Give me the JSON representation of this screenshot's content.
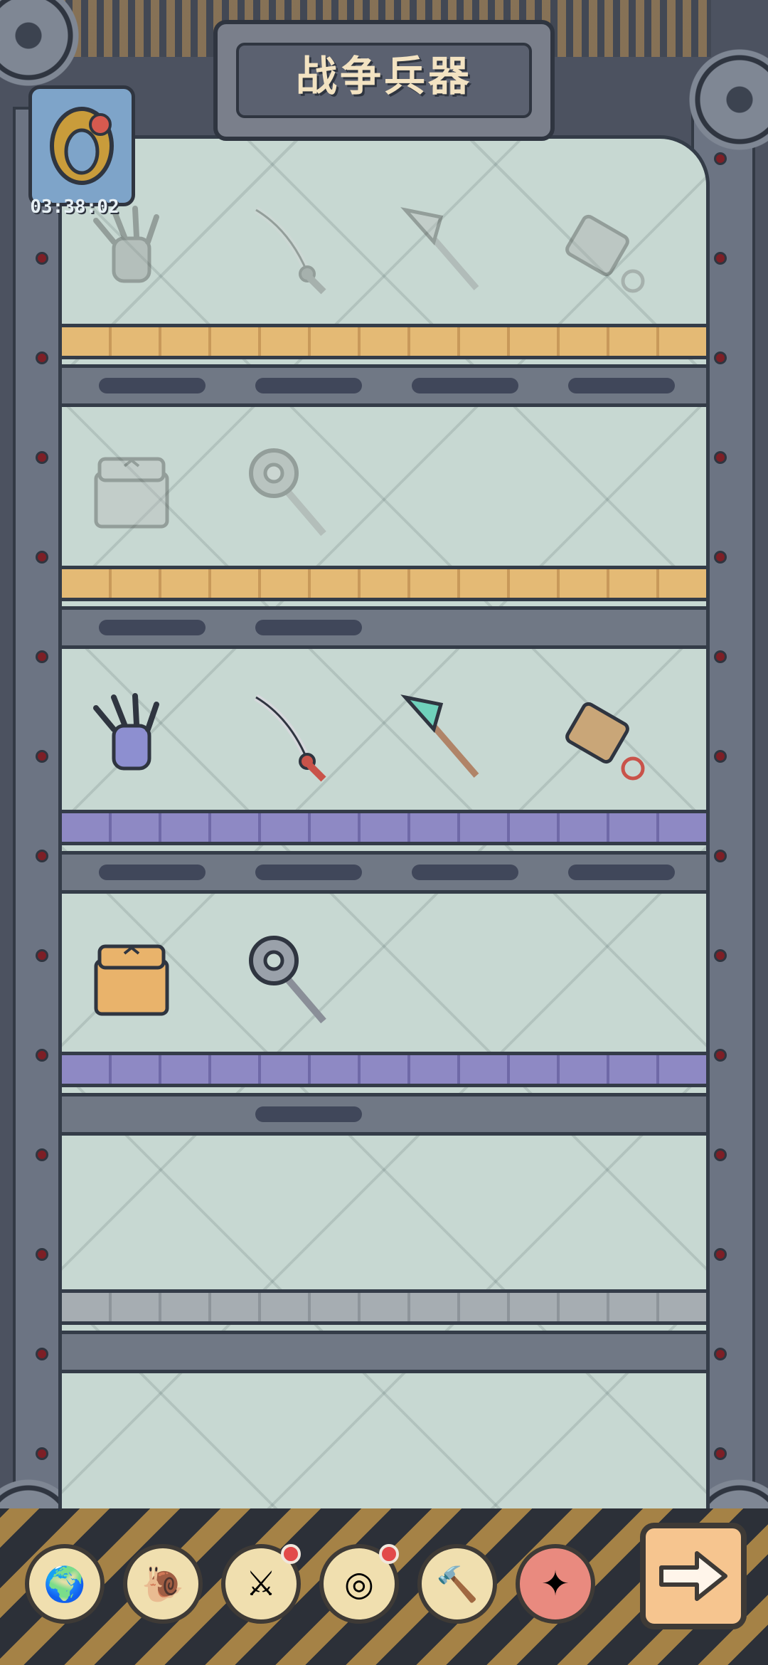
{
  "header": {
    "title": "战争兵器"
  },
  "timer": {
    "value": "03:38:02"
  },
  "shelves": [
    {
      "items": [
        "claw-gauntlet",
        "curved-sword",
        "spear",
        "blaster-rifle"
      ],
      "collected": false
    },
    {
      "items": [
        "treasure-chest",
        "spiral-staff"
      ],
      "collected": false
    },
    {
      "items": [
        "claw-gauntlet",
        "curved-sword",
        "spear",
        "blaster-rifle"
      ],
      "collected": true
    },
    {
      "items": [
        "treasure-chest",
        "spiral-staff"
      ],
      "collected": true
    }
  ],
  "nav": [
    {
      "icon": "globe-icon",
      "glyph": "🌍",
      "badge": false
    },
    {
      "icon": "snail-icon",
      "glyph": "🐌",
      "badge": false
    },
    {
      "icon": "sword-icon",
      "glyph": "⚔",
      "badge": true
    },
    {
      "icon": "spiral-icon",
      "glyph": "◎",
      "badge": true
    },
    {
      "icon": "hammer-icon",
      "glyph": "🔨",
      "badge": false
    },
    {
      "icon": "gun-icon",
      "glyph": "✦",
      "badge": false
    }
  ],
  "next_button": {
    "icon": "arrow-right-icon"
  }
}
